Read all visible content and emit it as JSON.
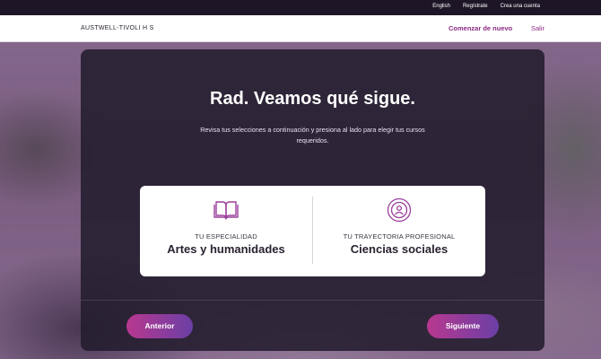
{
  "topbar": {
    "links": [
      "English",
      "Regístrate",
      "Crea una cuenta"
    ]
  },
  "header": {
    "brand": "AUSTWELL-TIVOLI H S",
    "start_over": "Comenzar de nuevo",
    "exit": "Salir"
  },
  "main": {
    "title": "Rad. Veamos qué sigue.",
    "subtitle": "Revisa tus selecciones a continuación y presiona al lado para elegir tus cursos requeridos.",
    "selections": [
      {
        "label": "TU ESPECIALIDAD",
        "value": "Artes y humanidades",
        "icon": "book-icon"
      },
      {
        "label": "TU TRAYECTORIA PROFESIONAL",
        "value": "Ciencias sociales",
        "icon": "person-badge-icon"
      }
    ],
    "prev_label": "Anterior",
    "next_label": "Siguiente"
  },
  "colors": {
    "accent": "#8a2a82",
    "button_start": "#b8388f",
    "button_end": "#6b3fa6",
    "icon": "#9a3f9c"
  }
}
